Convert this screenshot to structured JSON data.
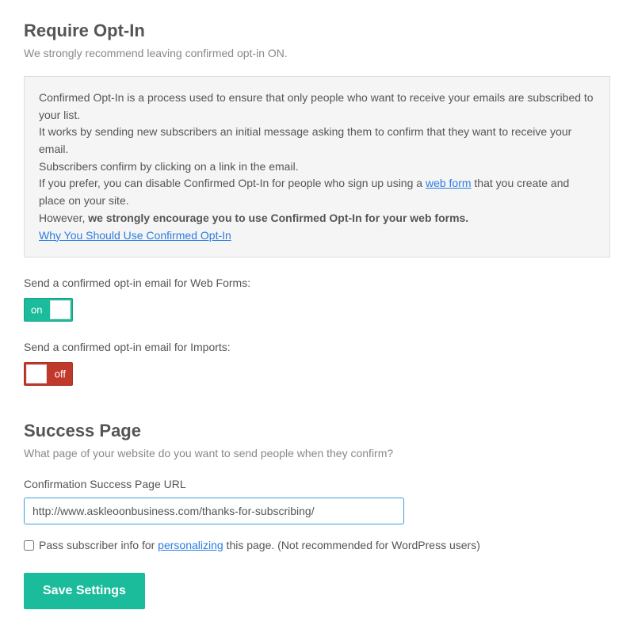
{
  "optin": {
    "title": "Require Opt-In",
    "subtitle": "We strongly recommend leaving confirmed opt-in ON.",
    "info": {
      "line1": "Confirmed Opt-In is a process used to ensure that only people who want to receive your emails are subscribed to your list.",
      "line2": "It works by sending new subscribers an initial message asking them to confirm that they want to receive your email.",
      "line3": "Subscribers confirm by clicking on a link in the email.",
      "line4a": "If you prefer, you can disable Confirmed Opt-In for people who sign up using a ",
      "line4_link": "web form",
      "line4b": " that you create and place on your site.",
      "line5a": "However, ",
      "line5_strong": "we strongly encourage you to use Confirmed Opt-In for your web forms.",
      "link2": "Why You Should Use Confirmed Opt-In"
    },
    "toggles": {
      "webforms_label": "Send a confirmed opt-in email for Web Forms:",
      "webforms_state": "on",
      "imports_label": "Send a confirmed opt-in email for Imports:",
      "imports_state": "off"
    }
  },
  "success": {
    "title": "Success Page",
    "subtitle": "What page of your website do you want to send people when they confirm?",
    "url_label": "Confirmation Success Page URL",
    "url_value": "http://www.askleoonbusiness.com/thanks-for-subscribing/",
    "checkbox_pre": "Pass subscriber info for ",
    "checkbox_link": "personalizing",
    "checkbox_post": " this page. (Not recommended for WordPress users)"
  },
  "actions": {
    "save_label": "Save Settings"
  }
}
